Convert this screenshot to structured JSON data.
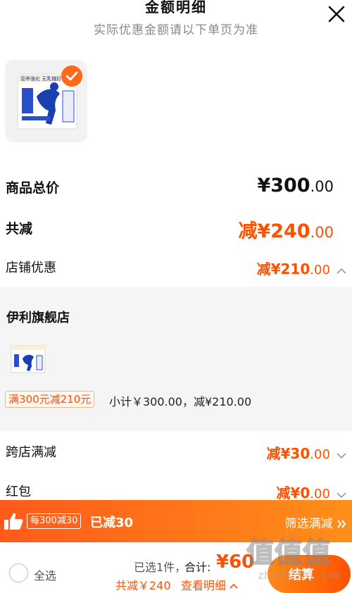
{
  "header": {
    "title": "金额明细",
    "subtitle": "实际优惠金额请以下单页为准"
  },
  "product": {
    "image_text": "营养强化 无乳糖好吸收",
    "selected": true
  },
  "summary": {
    "total_label": "商品总价",
    "total_value": "¥300",
    "total_decimals": ".00",
    "reduce_label": "共减",
    "reduce_value": "减¥240",
    "reduce_decimals": ".00"
  },
  "shop_discount": {
    "label": "店铺优惠",
    "value": "减¥210",
    "decimals": ".00",
    "expanded": true
  },
  "store": {
    "name": "伊利旗舰店",
    "tag": "满300元减210元",
    "subtotal": "小计￥300.00，减¥210.00"
  },
  "cross_store": {
    "label": "跨店满减",
    "value": "减¥30",
    "decimals": ".00"
  },
  "red_packet": {
    "label": "红包",
    "value": "减¥0",
    "decimals": ".00"
  },
  "promo_bar": {
    "tag": "每300减30",
    "text": "已减30",
    "link": "筛选满减"
  },
  "bottom_bar": {
    "select_all": "全选",
    "selected_count": "已选1件，",
    "total_label": "合计:",
    "total_value": "¥60",
    "reduce_text": "共减￥240",
    "detail_link": "查看明细",
    "checkout": "结算"
  },
  "watermark": {
    "text": "值值值",
    "site": "zhizhizhi.com"
  },
  "colors": {
    "accent": "#ff5000",
    "promo_gradient_start": "#ff5a1a",
    "promo_gradient_end": "#ff8f1a",
    "store_panel_bg": "#f5f5f5"
  }
}
